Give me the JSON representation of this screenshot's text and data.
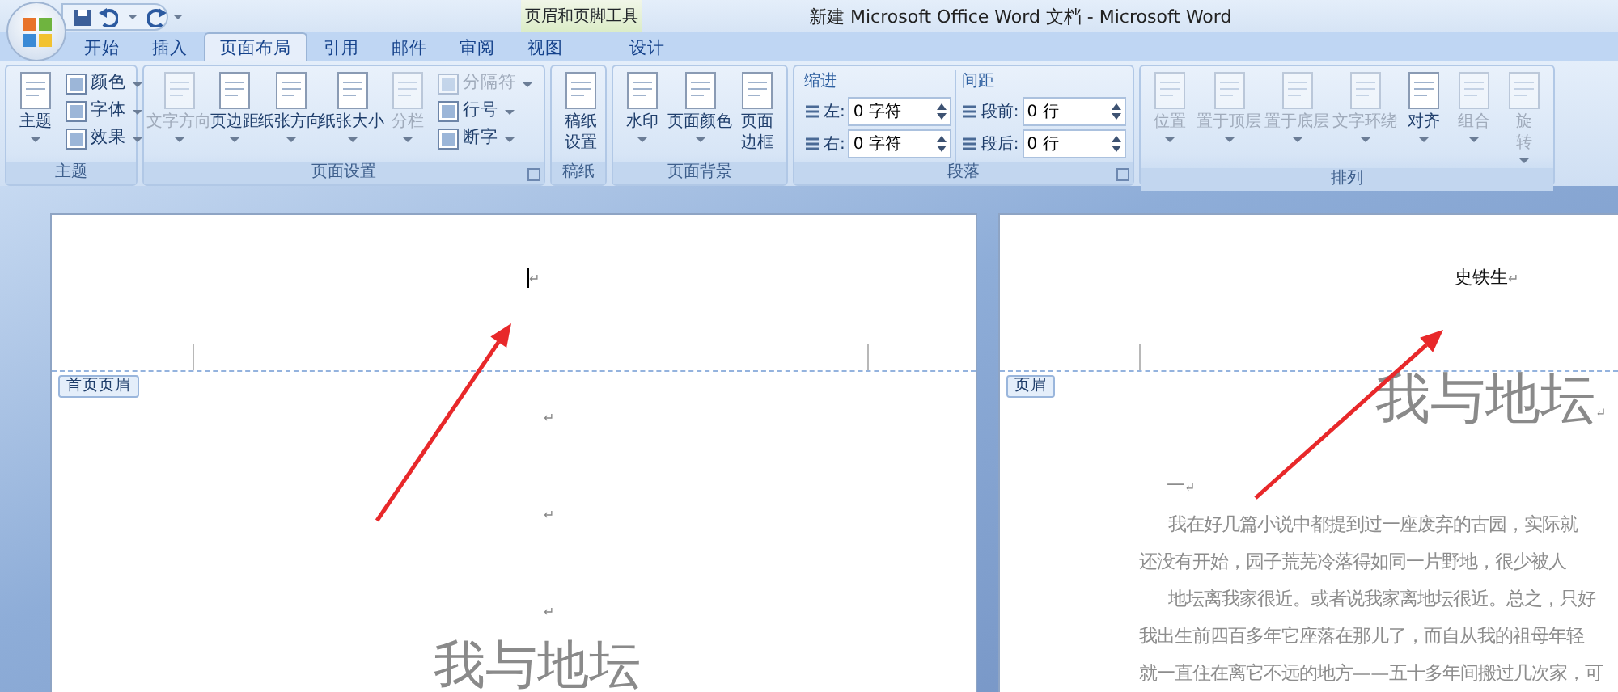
{
  "window": {
    "title": "新建 Microsoft Office Word 文档 - Microsoft Word"
  },
  "contextual_group": {
    "label": "页眉和页脚工具"
  },
  "tabs": [
    {
      "label": "开始",
      "selected": false,
      "kind": "standard"
    },
    {
      "label": "插入",
      "selected": false,
      "kind": "standard"
    },
    {
      "label": "页面布局",
      "selected": true,
      "kind": "standard"
    },
    {
      "label": "引用",
      "selected": false,
      "kind": "standard"
    },
    {
      "label": "邮件",
      "selected": false,
      "kind": "standard"
    },
    {
      "label": "审阅",
      "selected": false,
      "kind": "standard"
    },
    {
      "label": "视图",
      "selected": false,
      "kind": "standard"
    },
    {
      "label": "设计",
      "selected": false,
      "kind": "contextual"
    }
  ],
  "ribbon": {
    "groups": [
      {
        "label": "主题",
        "launcher": false,
        "items": [
          {
            "kind": "large",
            "label": "主题",
            "disabled": false,
            "dropdown": true
          },
          {
            "kind": "stack",
            "items": [
              {
                "label": "颜色",
                "disabled": false,
                "dropdown": true
              },
              {
                "label": "字体",
                "disabled": false,
                "dropdown": true
              },
              {
                "label": "效果",
                "disabled": false,
                "dropdown": true
              }
            ]
          }
        ]
      },
      {
        "label": "页面设置",
        "launcher": true,
        "items": [
          {
            "kind": "large",
            "label": "文字方向",
            "disabled": true,
            "dropdown": true
          },
          {
            "kind": "large",
            "label": "页边距",
            "disabled": false,
            "dropdown": true
          },
          {
            "kind": "large",
            "label": "纸张方向",
            "disabled": false,
            "dropdown": true
          },
          {
            "kind": "large",
            "label": "纸张大小",
            "disabled": false,
            "dropdown": true
          },
          {
            "kind": "large",
            "label": "分栏",
            "disabled": true,
            "dropdown": true
          },
          {
            "kind": "stack",
            "items": [
              {
                "label": "分隔符",
                "disabled": true,
                "dropdown": true
              },
              {
                "label": "行号",
                "disabled": false,
                "dropdown": true
              },
              {
                "label": "断字",
                "disabled": false,
                "dropdown": true
              }
            ]
          }
        ]
      },
      {
        "label": "稿纸",
        "launcher": false,
        "items": [
          {
            "kind": "large",
            "label": "稿纸设置",
            "disabled": false,
            "dropdown": false
          }
        ]
      },
      {
        "label": "页面背景",
        "launcher": false,
        "items": [
          {
            "kind": "large",
            "label": "水印",
            "disabled": false,
            "dropdown": true
          },
          {
            "kind": "large",
            "label": "页面颜色",
            "disabled": false,
            "dropdown": true
          },
          {
            "kind": "large",
            "label": "页面边框",
            "disabled": false,
            "dropdown": false
          }
        ]
      },
      {
        "label": "段落",
        "launcher": true,
        "items": [
          {
            "kind": "spinners",
            "heading": "缩进",
            "fields": [
              {
                "label": "左:",
                "value": "0 字符"
              },
              {
                "label": "右:",
                "value": "0 字符"
              }
            ]
          },
          {
            "kind": "spinners",
            "heading": "间距",
            "fields": [
              {
                "label": "段前:",
                "value": "0 行"
              },
              {
                "label": "段后:",
                "value": "0 行"
              }
            ]
          }
        ]
      },
      {
        "label": "排列",
        "launcher": false,
        "items": [
          {
            "kind": "large",
            "label": "位置",
            "disabled": true,
            "dropdown": true
          },
          {
            "kind": "large",
            "label": "置于顶层",
            "disabled": true,
            "dropdown": true
          },
          {
            "kind": "large",
            "label": "置于底层",
            "disabled": true,
            "dropdown": true
          },
          {
            "kind": "large",
            "label": "文字环绕",
            "disabled": true,
            "dropdown": true
          },
          {
            "kind": "large",
            "label": "对齐",
            "disabled": false,
            "dropdown": true
          },
          {
            "kind": "large",
            "label": "组合",
            "disabled": true,
            "dropdown": true
          },
          {
            "kind": "large",
            "label": "旋转",
            "disabled": true,
            "dropdown": true
          }
        ]
      }
    ]
  },
  "pages": [
    {
      "header_tag": "首页页眉",
      "header_mark": "↵",
      "cursor": true,
      "body": [
        {
          "kind": "mark",
          "text": "↵"
        },
        {
          "kind": "mark",
          "text": "↵"
        },
        {
          "kind": "mark",
          "text": "↵"
        },
        {
          "kind": "title",
          "text": "我与地坛"
        }
      ]
    },
    {
      "header_tag": "页眉",
      "header_text": "史铁生",
      "header_mark": "↵",
      "cursor": false,
      "body": [
        {
          "kind": "title",
          "text": "我与地坛",
          "mark": "↵"
        },
        {
          "kind": "heading",
          "text": "一",
          "mark": "↵"
        },
        {
          "kind": "line",
          "text": "我在好几篇小说中都提到过一座废弃的古园，实际就",
          "indent": true
        },
        {
          "kind": "line",
          "text": "还没有开始，园子荒芜冷落得如同一片野地，很少被人",
          "indent": false
        },
        {
          "kind": "line",
          "text": "地坛离我家很近。或者说我家离地坛很近。总之，只好",
          "indent": true
        },
        {
          "kind": "line",
          "text": "我出生前四百多年它座落在那儿了，而自从我的祖母年轻",
          "indent": false
        },
        {
          "kind": "line",
          "text": "就一直住在离它不远的地方——五十多年间搬过几次家，可",
          "indent": false
        }
      ]
    }
  ]
}
